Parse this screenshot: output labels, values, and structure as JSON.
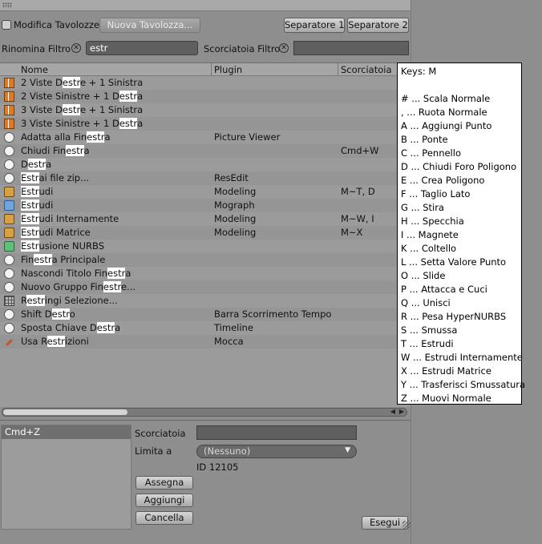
{
  "top": {
    "checkbox_label": "Modifica Tavolozze",
    "new_palette": "Nuova Tavolozza...",
    "separator1": "Separatore 1",
    "separator2": "Separatore 2"
  },
  "filters": {
    "rename_label": "Rinomina Filtro",
    "rename_value": "estr",
    "shortcut_label": "Scorciatoia Filtro",
    "shortcut_value": ""
  },
  "table": {
    "headers": {
      "name": "Nome",
      "plugin": "Plugin",
      "shortcut": "Scorciatoia"
    },
    "rows": [
      {
        "icon": "layout-icon",
        "name": [
          "2 Viste D",
          "estr",
          "e + 1 Sinistra"
        ],
        "plugin": "",
        "shortcut": ""
      },
      {
        "icon": "layout-icon",
        "name": [
          "2 Viste Sinistre + 1 D",
          "estr",
          "a"
        ],
        "plugin": "",
        "shortcut": ""
      },
      {
        "icon": "layout-icon",
        "name": [
          "3 Viste D",
          "estr",
          "e + 1 Sinistra"
        ],
        "plugin": "",
        "shortcut": ""
      },
      {
        "icon": "layout-icon",
        "name": [
          "3 Viste Sinistre + 1 D",
          "estr",
          "a"
        ],
        "plugin": "",
        "shortcut": ""
      },
      {
        "icon": "circle-icon",
        "name": [
          "Adatta alla Fin",
          "estr",
          "a"
        ],
        "plugin": "Picture Viewer",
        "shortcut": ""
      },
      {
        "icon": "circle-icon",
        "name": [
          "Chiudi Fin",
          "estr",
          "a"
        ],
        "plugin": "",
        "shortcut": "Cmd+W"
      },
      {
        "icon": "circle-icon",
        "name": [
          "D",
          "estr",
          "a"
        ],
        "plugin": "",
        "shortcut": ""
      },
      {
        "icon": "circle-icon",
        "name": [
          "",
          "Estr",
          "ai file zip..."
        ],
        "plugin": "ResEdit",
        "shortcut": ""
      },
      {
        "icon": "extrude-icon",
        "name": [
          "",
          "Estr",
          "udi"
        ],
        "plugin": "Modeling",
        "shortcut": "M~T, D"
      },
      {
        "icon": "mograph-extrude-icon",
        "name": [
          "",
          "Estr",
          "udi"
        ],
        "plugin": "Mograph",
        "shortcut": ""
      },
      {
        "icon": "extrude-inner-icon",
        "name": [
          "",
          "Estr",
          "udi Internamente"
        ],
        "plugin": "Modeling",
        "shortcut": "M~W, I"
      },
      {
        "icon": "extrude-matrix-icon",
        "name": [
          "",
          "Estr",
          "udi Matrice"
        ],
        "plugin": "Modeling",
        "shortcut": "M~X"
      },
      {
        "icon": "nurbs-extrude-icon",
        "name": [
          "",
          "Estr",
          "usione NURBS"
        ],
        "plugin": "",
        "shortcut": ""
      },
      {
        "icon": "circle-icon",
        "name": [
          "Fin",
          "estr",
          "a Principale"
        ],
        "plugin": "",
        "shortcut": ""
      },
      {
        "icon": "circle-icon",
        "name": [
          "Nascondi Titolo Fin",
          "estr",
          "a"
        ],
        "plugin": "",
        "shortcut": ""
      },
      {
        "icon": "circle-icon",
        "name": [
          "Nuovo Gruppo Fin",
          "estr",
          "e..."
        ],
        "plugin": "",
        "shortcut": ""
      },
      {
        "icon": "grid-icon",
        "name": [
          "R",
          "estr",
          "ingi Selezione..."
        ],
        "plugin": "",
        "shortcut": ""
      },
      {
        "icon": "circle-icon",
        "name": [
          "Shift D",
          "estr",
          "o"
        ],
        "plugin": "Barra Scorrimento Tempo",
        "shortcut": ""
      },
      {
        "icon": "circle-icon",
        "name": [
          "Sposta Chiave D",
          "estr",
          "a"
        ],
        "plugin": "Timeline",
        "shortcut": ""
      },
      {
        "icon": "pin-icon",
        "name": [
          "Usa R",
          "estr",
          "izioni"
        ],
        "plugin": "Mocca",
        "shortcut": ""
      }
    ]
  },
  "bottom": {
    "shortcut_item": "Cmd+Z",
    "shortcut_label": "Scorciatoia",
    "limit_label": "Limita a",
    "limit_value": "(Nessuno)",
    "id_text": "ID 12105",
    "assign": "Assegna",
    "add": "Aggiungi",
    "delete": "Cancella",
    "execute": "Esegui"
  },
  "popup": {
    "lines": [
      "Keys: M",
      "",
      "# ... Scala Normale",
      ", ... Ruota Normale",
      "A ... Aggiungi Punto",
      "B ... Ponte",
      "C ... Pennello",
      "D ... Chiudi Foro Poligono",
      "E ... Crea Poligono",
      "F ... Taglio Lato",
      "G ... Stira",
      "H ... Specchia",
      "I ... Magnete",
      "K ... Coltello",
      "L ... Setta Valore Punto",
      "O ... Slide",
      "P ... Attacca e Cuci",
      "Q ... Unisci",
      "R ... Pesa HyperNURBS",
      "S ... Smussa",
      "T ... Estrudi",
      "W ... Estrudi Internamente",
      "X ... Estrudi Matrice",
      "Y ... Trasferisci Smussatura",
      "Z ... Muovi Normale"
    ]
  }
}
